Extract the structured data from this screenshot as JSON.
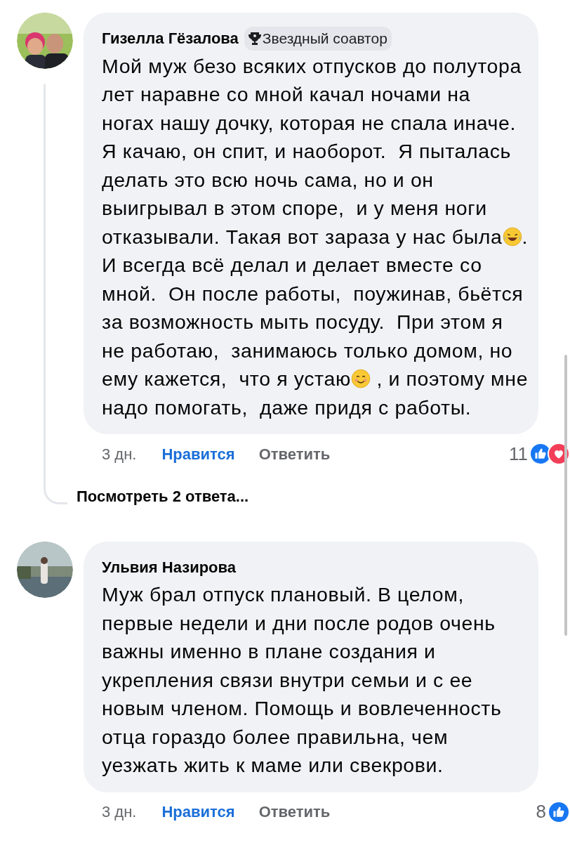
{
  "comments": [
    {
      "author": "Гизелла Гёзалова",
      "badge": "Звездный соавтор",
      "body": [
        {
          "kind": "text",
          "text": "Мой муж безо всяких отпусков до полутора лет наравне со мной качал ночами на ногах нашу дочку, которая не спала иначе.  Я качаю, он спит, и наоборот.  Я пыталась делать это всю ночь сама, но и он выигрывал в этом споре,  и у меня ноги отказывали. Такая вот зараза у нас была"
        },
        {
          "kind": "laugh"
        },
        {
          "kind": "text",
          "text": ". И всегда всё делал и делает вместе со мной.  Он после работы,  поужинав, бьётся за возможность мыть посуду.  При этом я не работаю,  занимаюсь только домом, но ему кажется,  что я устаю"
        },
        {
          "kind": "smile"
        },
        {
          "kind": "text",
          "text": " , и поэтому мне надо помогать,  даже придя с работы."
        }
      ],
      "time": "3 дн.",
      "like": "Нравится",
      "liked": true,
      "reply": "Ответить",
      "count": "11",
      "reactions": [
        {
          "kind": "like"
        },
        {
          "kind": "love"
        }
      ],
      "replies_link": "Посмотреть 2 ответа..."
    },
    {
      "author": "Ульвия Назирова",
      "body": [
        {
          "kind": "text",
          "text": "Муж брал отпуск плановый. В целом, первые недели и дни после родов очень важны именно в плане создания и укрепления связи внутри семьи и с ее новым членом. Помощь и вовлеченность отца гораздо более правильна, чем уезжать жить к маме или свекрови."
        }
      ],
      "time": "3 дн.",
      "like": "Нравится",
      "liked": true,
      "reply": "Ответить",
      "count": "8",
      "reactions": [
        {
          "kind": "like"
        }
      ]
    }
  ]
}
